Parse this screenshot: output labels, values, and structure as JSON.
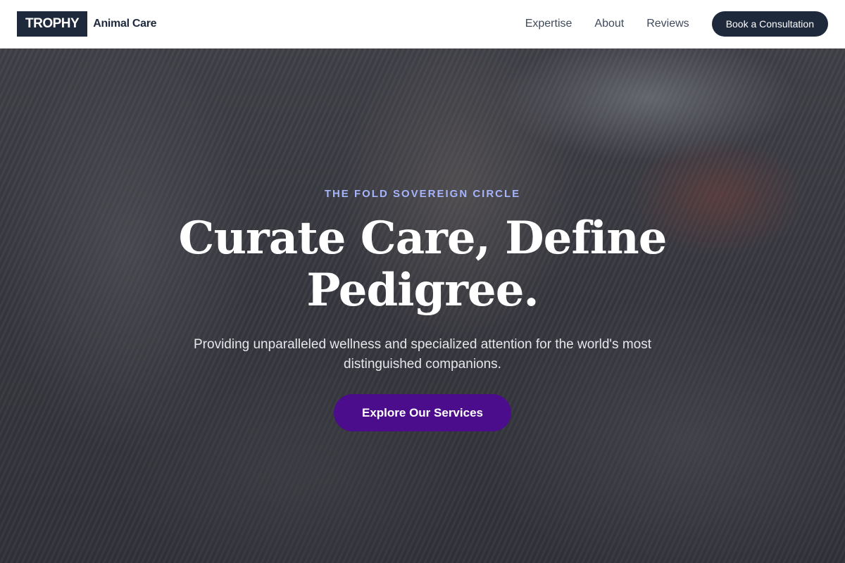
{
  "header": {
    "logo_badge": "TROPHY",
    "logo_text": "Animal Care",
    "nav": [
      {
        "label": "Expertise"
      },
      {
        "label": "About"
      },
      {
        "label": "Reviews"
      }
    ],
    "cta_label": "Book a Consultation"
  },
  "hero": {
    "background_image": "tabby-cats-cuddling-photo",
    "eyebrow": "THE FOLD SOVEREIGN CIRCLE",
    "headline": "Curate Care, Define Pedigree.",
    "subtext": "Providing unparalleled wellness and specialized attention for the world's most distinguished companions.",
    "button_label": "Explore Our Services"
  },
  "colors": {
    "brand_dark": "#1e293b",
    "accent_purple": "#4c0d8c",
    "eyebrow_lavender": "#a5b4fc"
  }
}
